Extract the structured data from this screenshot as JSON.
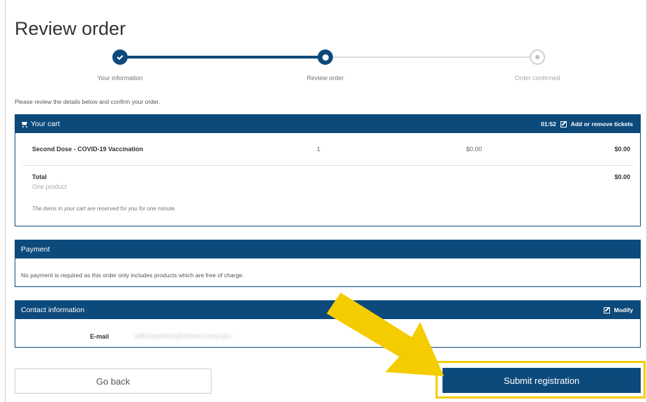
{
  "page": {
    "title": "Review order",
    "intro": "Please review the details below and confirm your order."
  },
  "stepper": {
    "steps": [
      {
        "label": "Your information",
        "state": "done"
      },
      {
        "label": "Review order",
        "state": "current"
      },
      {
        "label": "Order confirmed",
        "state": "pending"
      }
    ]
  },
  "cart": {
    "title": "Your cart",
    "timer": "01:52",
    "add_remove_label": "Add or remove tickets",
    "items": [
      {
        "name": "Second Dose - COVID-19 Vaccination",
        "quantity": "1",
        "price": "$0.00",
        "subtotal": "$0.00"
      }
    ],
    "total_label": "Total",
    "total_sub": "One product",
    "total_value": "$0.00",
    "note": "The items in your cart are reserved for you for one minute."
  },
  "payment": {
    "title": "Payment",
    "text": "No payment is required as this order only includes products which are free of charge."
  },
  "contact": {
    "title": "Contact information",
    "modify_label": "Modify",
    "email_label": "E-mail",
    "email_value": "jeffrey.peterson@mclean.county.gov"
  },
  "actions": {
    "back_label": "Go back",
    "submit_label": "Submit registration"
  },
  "colors": {
    "primary": "#0d4a7c",
    "highlight": "#f3cd00",
    "inactive": "#dcdcdc"
  },
  "icons": {
    "cart": "shopping-cart-icon",
    "edit": "edit-icon",
    "step_done": "check-icon",
    "pointer": "yellow-arrow-icon"
  }
}
